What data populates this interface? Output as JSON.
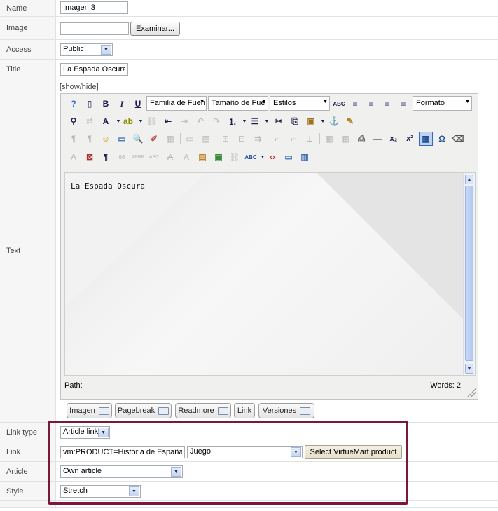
{
  "fields": {
    "name": {
      "label": "Name",
      "value": "Imagen 3"
    },
    "image": {
      "label": "Image",
      "value": "",
      "browse_label": "Examinar..."
    },
    "access": {
      "label": "Access",
      "value": "Public"
    },
    "title": {
      "label": "Title",
      "value": "La Espada Oscura"
    },
    "text": {
      "label": "Text",
      "toggle_label": "[show/hide]"
    },
    "link_type": {
      "label": "Link type",
      "value": "Article link"
    },
    "link": {
      "label": "Link",
      "value": "vm:PRODUCT=Historia de España",
      "category": "Juego",
      "select_button": "Select VirtueMart product"
    },
    "article": {
      "label": "Article",
      "value": "Own article"
    },
    "style": {
      "label": "Style",
      "value": "Stretch"
    }
  },
  "editor": {
    "font_family": "Familia de Fuen",
    "font_size": "Tamaño de Fue",
    "styles": "Estilos",
    "format": "Formato",
    "content_text": "La Espada Oscura",
    "path_label": "Path:",
    "words_label": "Words: 2",
    "buttons": [
      "Imagen",
      "Pagebreak",
      "Readmore",
      "Link",
      "Versiones"
    ]
  },
  "colors": {
    "highlight_border": "#7b1838"
  }
}
